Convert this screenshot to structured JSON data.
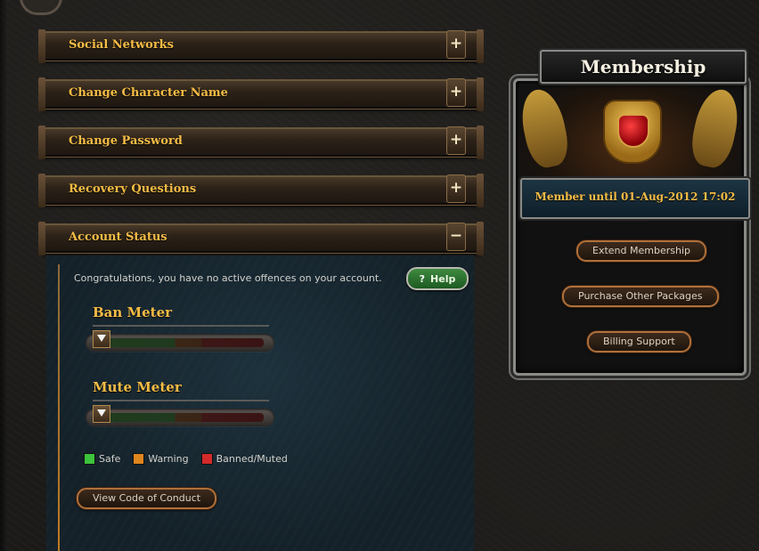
{
  "accordion": {
    "sections": [
      {
        "label": "Social Networks",
        "toggle": "+"
      },
      {
        "label": "Change Character Name",
        "toggle": "+"
      },
      {
        "label": "Change Password",
        "toggle": "+"
      },
      {
        "label": "Recovery Questions",
        "toggle": "+"
      },
      {
        "label": "Account Status",
        "toggle": "−"
      }
    ]
  },
  "account_status": {
    "message": "Congratulations, you have no active offences on your account.",
    "help_label": "Help",
    "help_icon": "?",
    "meters": [
      {
        "title": "Ban Meter",
        "level": 0
      },
      {
        "title": "Mute Meter",
        "level": 0
      }
    ],
    "legend": [
      {
        "label": "Safe",
        "color": "#3cc43c"
      },
      {
        "label": "Warning",
        "color": "#e0861e"
      },
      {
        "label": "Banned/Muted",
        "color": "#d42a2a"
      }
    ],
    "conduct_button": "View Code of Conduct"
  },
  "membership": {
    "title": "Membership",
    "member_until": "Member until 01-Aug-2012 17:02",
    "buttons": {
      "extend": "Extend Membership",
      "purchase": "Purchase Other Packages",
      "billing": "Billing Support"
    }
  },
  "colors": {
    "accent_gold": "#f5bc45",
    "panel_bg": "#142129",
    "button_border": "#b0703a"
  }
}
